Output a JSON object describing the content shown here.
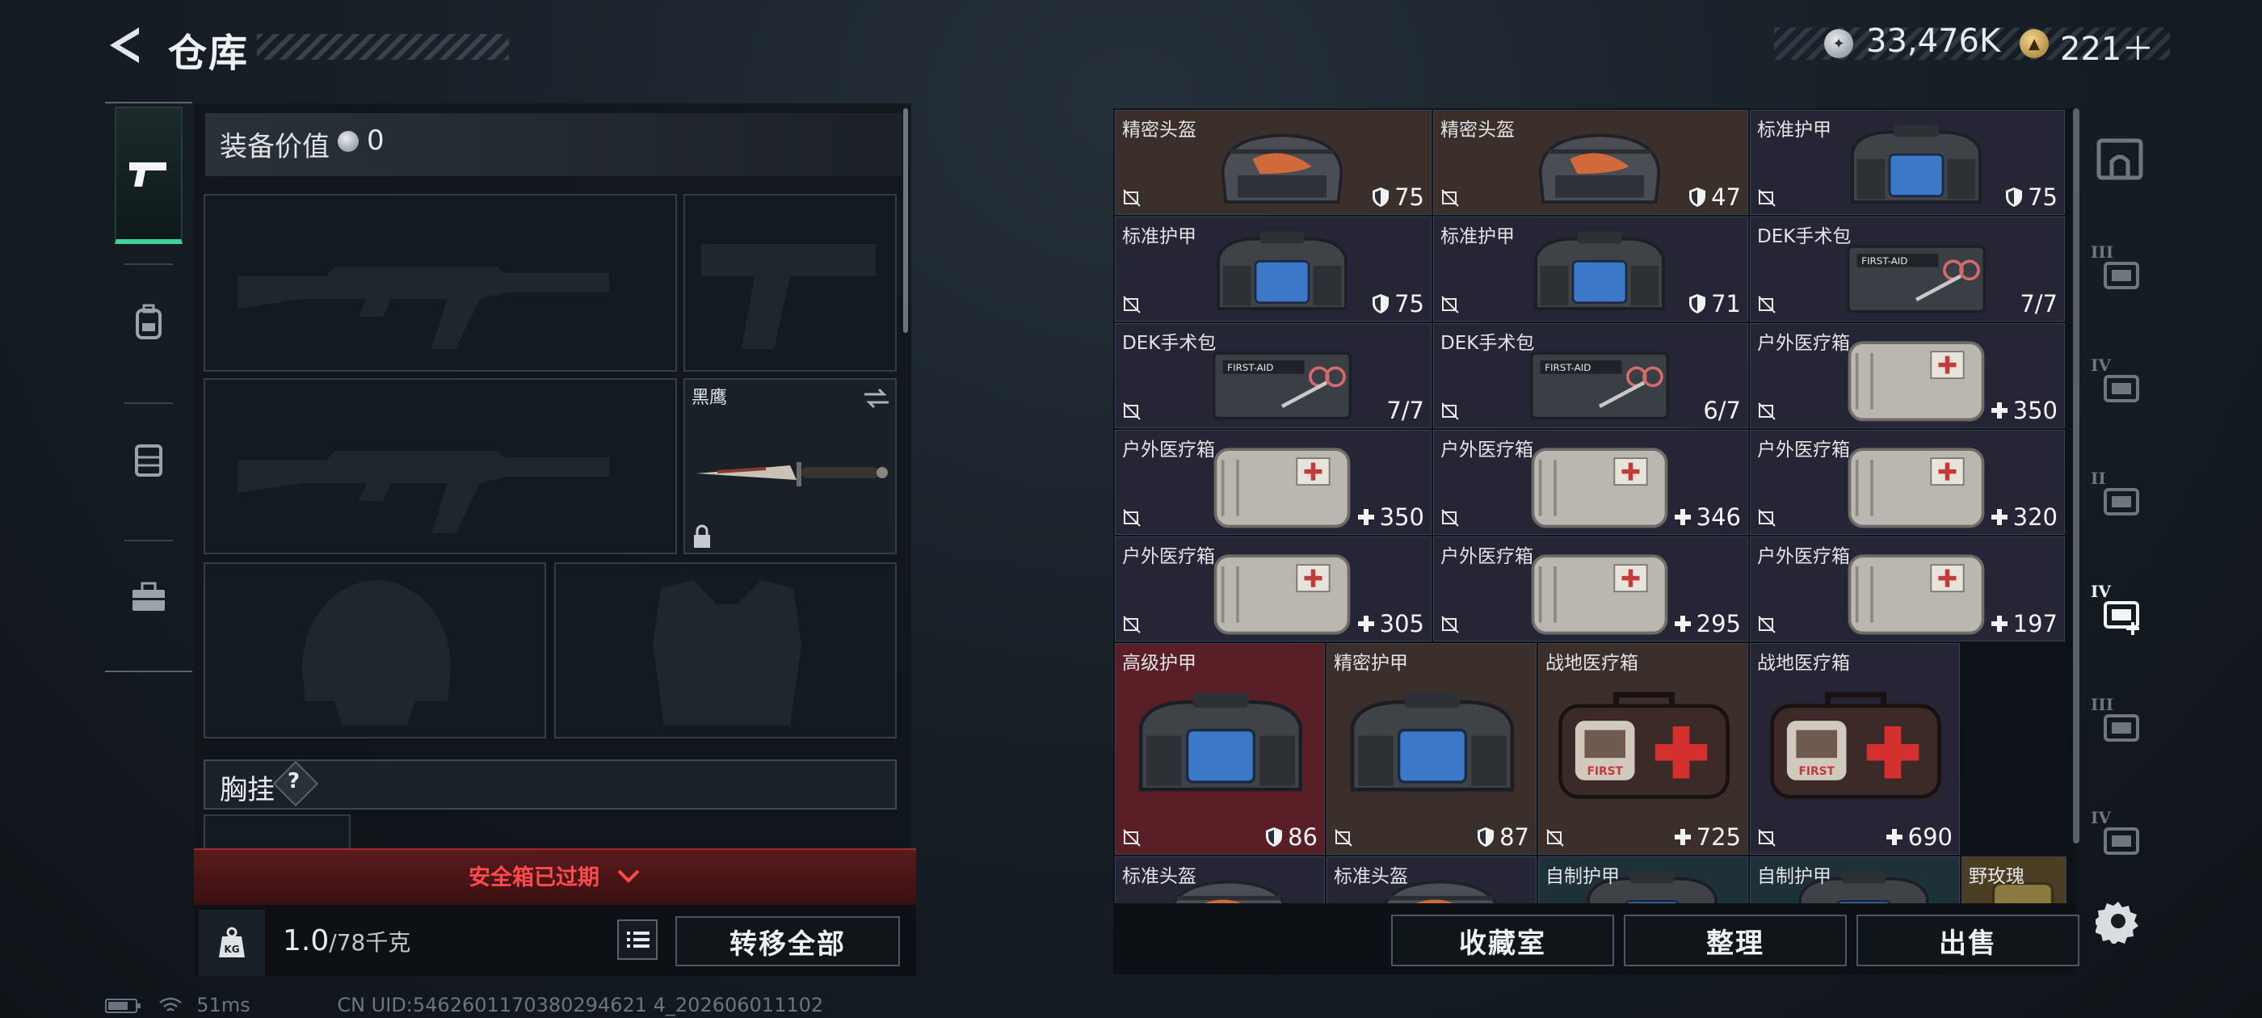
{
  "header": {
    "title": "仓库",
    "silver_amount": "33,476K",
    "gold_amount": "221＋"
  },
  "left_tabs": [
    {
      "name": "weapons",
      "icon": "pistol-icon",
      "active": true
    },
    {
      "name": "gear",
      "icon": "backpack-icon",
      "active": false
    },
    {
      "name": "chest",
      "icon": "vest-icon",
      "active": false
    },
    {
      "name": "tools",
      "icon": "toolbox-icon",
      "active": false
    }
  ],
  "loadout": {
    "value_label": "装备价值",
    "value": "0",
    "melee_name": "黑鹰",
    "chest_rig_label": "胸挂",
    "chest_rig_help": "?",
    "safebox_text": "安全箱已过期",
    "weight_value": "1.0",
    "weight_max": "/78千克",
    "transfer_all": "转移全部"
  },
  "stash": {
    "items": [
      {
        "name": "精密头盔",
        "value": "75",
        "stat": "shield",
        "type": "helmet",
        "color": "brown"
      },
      {
        "name": "精密头盔",
        "value": "47",
        "stat": "shield",
        "type": "helmet",
        "color": "brown"
      },
      {
        "name": "标准护甲",
        "value": "75",
        "stat": "shield",
        "type": "armor",
        "color": "purple"
      },
      {
        "name": "标准护甲",
        "value": "75",
        "stat": "shield",
        "type": "armor",
        "color": "purple"
      },
      {
        "name": "标准护甲",
        "value": "71",
        "stat": "shield",
        "type": "armor",
        "color": "purple"
      },
      {
        "name": "DEK手术包",
        "value": "7/7",
        "stat": "none",
        "type": "surgery",
        "color": "purple"
      },
      {
        "name": "DEK手术包",
        "value": "7/7",
        "stat": "none",
        "type": "surgery",
        "color": "purple"
      },
      {
        "name": "DEK手术包",
        "value": "6/7",
        "stat": "none",
        "type": "surgery",
        "color": "purple"
      },
      {
        "name": "户外医疗箱",
        "value": "350",
        "stat": "plus",
        "type": "medkit",
        "color": "purple"
      },
      {
        "name": "户外医疗箱",
        "value": "350",
        "stat": "plus",
        "type": "medkit",
        "color": "purple"
      },
      {
        "name": "户外医疗箱",
        "value": "346",
        "stat": "plus",
        "type": "medkit",
        "color": "purple"
      },
      {
        "name": "户外医疗箱",
        "value": "320",
        "stat": "plus",
        "type": "medkit",
        "color": "purple"
      },
      {
        "name": "户外医疗箱",
        "value": "305",
        "stat": "plus",
        "type": "medkit",
        "color": "purple"
      },
      {
        "name": "户外医疗箱",
        "value": "295",
        "stat": "plus",
        "type": "medkit",
        "color": "purple"
      },
      {
        "name": "户外医疗箱",
        "value": "197",
        "stat": "plus",
        "type": "medkit",
        "color": "purple"
      },
      {
        "name": "高级护甲",
        "value": "86",
        "stat": "shield",
        "type": "armor",
        "color": "red"
      },
      {
        "name": "精密护甲",
        "value": "87",
        "stat": "shield",
        "type": "armor",
        "color": "brown"
      },
      {
        "name": "战地医疗箱",
        "value": "725",
        "stat": "plus",
        "type": "firstaid",
        "color": "brown"
      },
      {
        "name": "战地医疗箱",
        "value": "690",
        "stat": "plus",
        "type": "firstaid",
        "color": "purple"
      },
      {
        "name": "标准头盔",
        "value": "",
        "stat": "none",
        "type": "helmet",
        "color": "purple"
      },
      {
        "name": "标准头盔",
        "value": "",
        "stat": "none",
        "type": "helmet",
        "color": "purple"
      },
      {
        "name": "自制护甲",
        "value": "",
        "stat": "none",
        "type": "armor",
        "color": "teal"
      },
      {
        "name": "自制护甲",
        "value": "",
        "stat": "none",
        "type": "armor",
        "color": "teal"
      },
      {
        "name": "野玫瑰",
        "value": "",
        "stat": "none",
        "type": "misc",
        "color": "gold"
      }
    ],
    "collection_room": "收藏室",
    "organize": "整理",
    "sell": "出售"
  },
  "right_nav": [
    {
      "icon": "vault-icon"
    },
    {
      "icon": "tier3-helmet-icon",
      "label": "III"
    },
    {
      "icon": "tier4-armor-icon",
      "label": "IV"
    },
    {
      "icon": "tier2-armor-icon",
      "label": "II"
    },
    {
      "icon": "tier4-medical-icon",
      "label": "IV",
      "active": true
    },
    {
      "icon": "tier3-helmet-alt-icon",
      "label": "III"
    },
    {
      "icon": "tier4-ammo-icon",
      "label": "IV"
    }
  ],
  "status": {
    "ping": "51ms",
    "uid": "CN UID:5462601170380294621 4_202606011102"
  },
  "colors": {
    "accent": "#3fd39a",
    "warning": "#ff4a4a",
    "rarity_brown": "#3a2f2a",
    "rarity_purple": "#252536",
    "rarity_red": "#5a1f26"
  }
}
